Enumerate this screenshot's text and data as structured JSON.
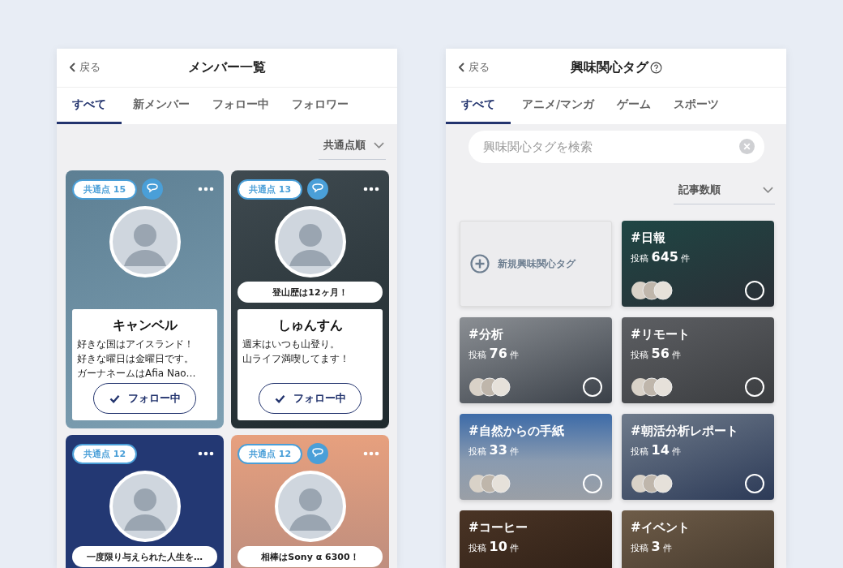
{
  "members_screen": {
    "back": "戻る",
    "title": "メンバー一覧",
    "tabs": [
      {
        "label": "すべて",
        "selected": true
      },
      {
        "label": "新メンバー",
        "selected": false
      },
      {
        "label": "フォロー中",
        "selected": false
      },
      {
        "label": "フォロワー",
        "selected": false
      }
    ],
    "sort": "共通点順",
    "members": [
      {
        "common": "共通点 15",
        "chat": true,
        "name": "キャンベル",
        "bio": [
          "好きな国はアイスランド！",
          "好きな曜日は金曜日です。",
          "ガーナネームはAfia Nao…"
        ],
        "follow": {
          "label": "フォロー中",
          "following": true
        }
      },
      {
        "common": "共通点 13",
        "chat": true,
        "bubble": "登山歴は12ヶ月！",
        "name": "しゅんすん",
        "bio": [
          "週末はいつも山登り。",
          "山ライフ満喫してます！"
        ],
        "follow": {
          "label": "フォロー中",
          "following": true
        }
      },
      {
        "common": "共通点 12",
        "chat": false,
        "bubble": "一度限り与えられた人生を…"
      },
      {
        "common": "共通点 12",
        "chat": true,
        "bubble": "相棒はSony α 6300！"
      }
    ]
  },
  "tags_screen": {
    "back": "戻る",
    "title": "興味関心タグ",
    "tabs": [
      {
        "label": "すべて",
        "selected": true
      },
      {
        "label": "アニメ/マンガ",
        "selected": false
      },
      {
        "label": "ゲーム",
        "selected": false
      },
      {
        "label": "スポーツ",
        "selected": false
      }
    ],
    "search": {
      "placeholder": "興味関心タグを検索"
    },
    "sort": "記事数順",
    "tags": [
      {
        "kind": "new",
        "label": "新規興味関心タグ"
      },
      {
        "kind": "tag",
        "name": "#日報",
        "prefix": "投稿",
        "count": "645",
        "unit": "件",
        "selected": false
      },
      {
        "kind": "tag",
        "name": "#分析",
        "prefix": "投稿",
        "count": "76",
        "unit": "件",
        "selected": false
      },
      {
        "kind": "tag",
        "name": "#リモート",
        "prefix": "投稿",
        "count": "56",
        "unit": "件",
        "selected": false
      },
      {
        "kind": "tag",
        "name": "#自然からの手紙",
        "prefix": "投稿",
        "count": "33",
        "unit": "件",
        "selected": false
      },
      {
        "kind": "tag",
        "name": "#朝活分析レポート",
        "prefix": "投稿",
        "count": "14",
        "unit": "件",
        "selected": false
      },
      {
        "kind": "tag",
        "name": "#コーヒー",
        "prefix": "投稿",
        "count": "10",
        "unit": "件"
      },
      {
        "kind": "tag",
        "name": "#イベント",
        "prefix": "投稿",
        "count": "3",
        "unit": "件"
      }
    ]
  }
}
